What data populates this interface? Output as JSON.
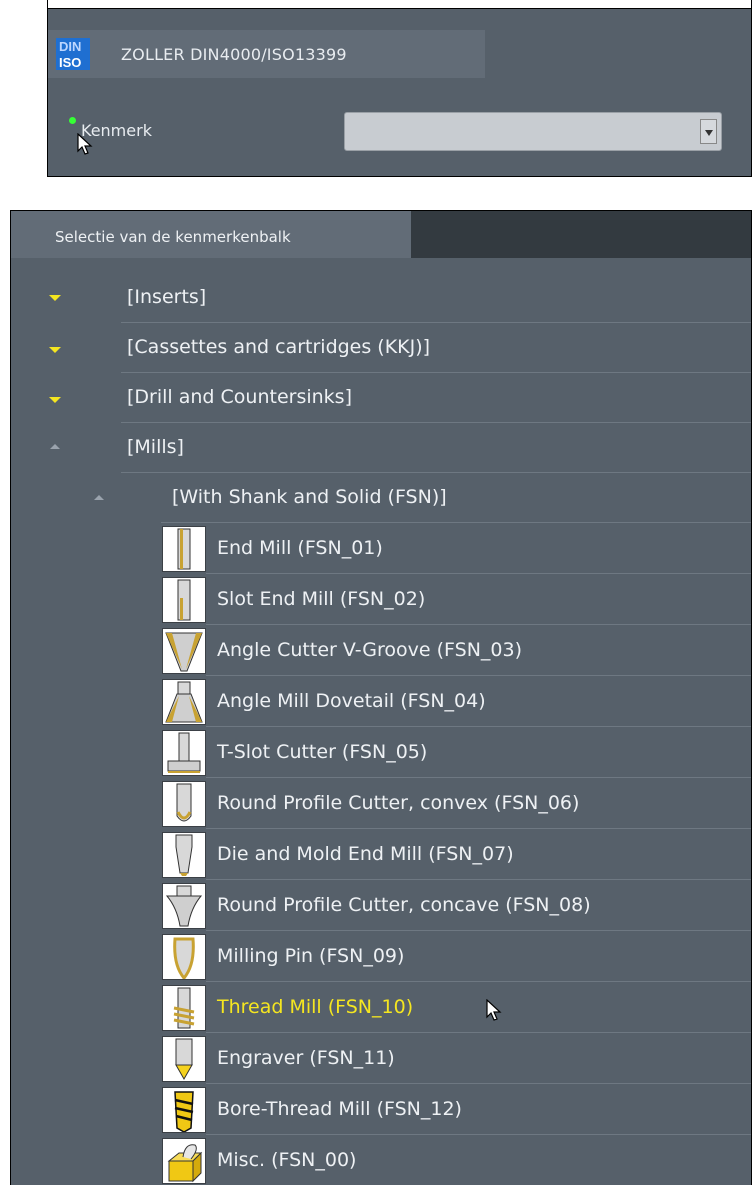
{
  "settings_panel": {
    "tab_label": "ZOLLER DIN4000/ISO13399",
    "icon": "din-iso-icon",
    "kenmerk_label": "Kenmerk",
    "kenmerk_value": "",
    "status_color": "#35ff35"
  },
  "tree_panel": {
    "tab_label": "Selectie van de kenmerkenbalk",
    "categories": [
      {
        "label": "[Inserts]",
        "state": "collapsed"
      },
      {
        "label": "[Cassettes and cartridges (KKJ)]",
        "state": "collapsed"
      },
      {
        "label": "[Drill and Countersinks]",
        "state": "collapsed"
      },
      {
        "label": "[Mills]",
        "state": "expanded"
      }
    ],
    "subcategory": {
      "label": "[With Shank and Solid (FSN)]",
      "state": "expanded"
    },
    "items": [
      {
        "label": "End Mill (FSN_01)",
        "icon": "end-mill-icon"
      },
      {
        "label": "Slot End Mill (FSN_02)",
        "icon": "slot-end-mill-icon"
      },
      {
        "label": "Angle Cutter V-Groove (FSN_03)",
        "icon": "angle-cutter-icon"
      },
      {
        "label": "Angle Mill Dovetail (FSN_04)",
        "icon": "dovetail-mill-icon"
      },
      {
        "label": "T-Slot Cutter (FSN_05)",
        "icon": "t-slot-cutter-icon"
      },
      {
        "label": "Round Profile Cutter, convex (FSN_06)",
        "icon": "convex-cutter-icon"
      },
      {
        "label": "Die and Mold End Mill (FSN_07)",
        "icon": "die-mold-mill-icon"
      },
      {
        "label": "Round Profile Cutter, concave (FSN_08)",
        "icon": "concave-cutter-icon"
      },
      {
        "label": "Milling Pin (FSN_09)",
        "icon": "milling-pin-icon"
      },
      {
        "label": "Thread Mill (FSN_10)",
        "icon": "thread-mill-icon",
        "highlighted": true
      },
      {
        "label": "Engraver (FSN_11)",
        "icon": "engraver-icon"
      },
      {
        "label": "Bore-Thread Mill (FSN_12)",
        "icon": "bore-thread-mill-icon"
      },
      {
        "label": "Misc. (FSN_00)",
        "icon": "misc-icon"
      }
    ],
    "highlight_color": "#f5e620",
    "text_color": "#eef1f4",
    "background_color": "#56606a"
  }
}
